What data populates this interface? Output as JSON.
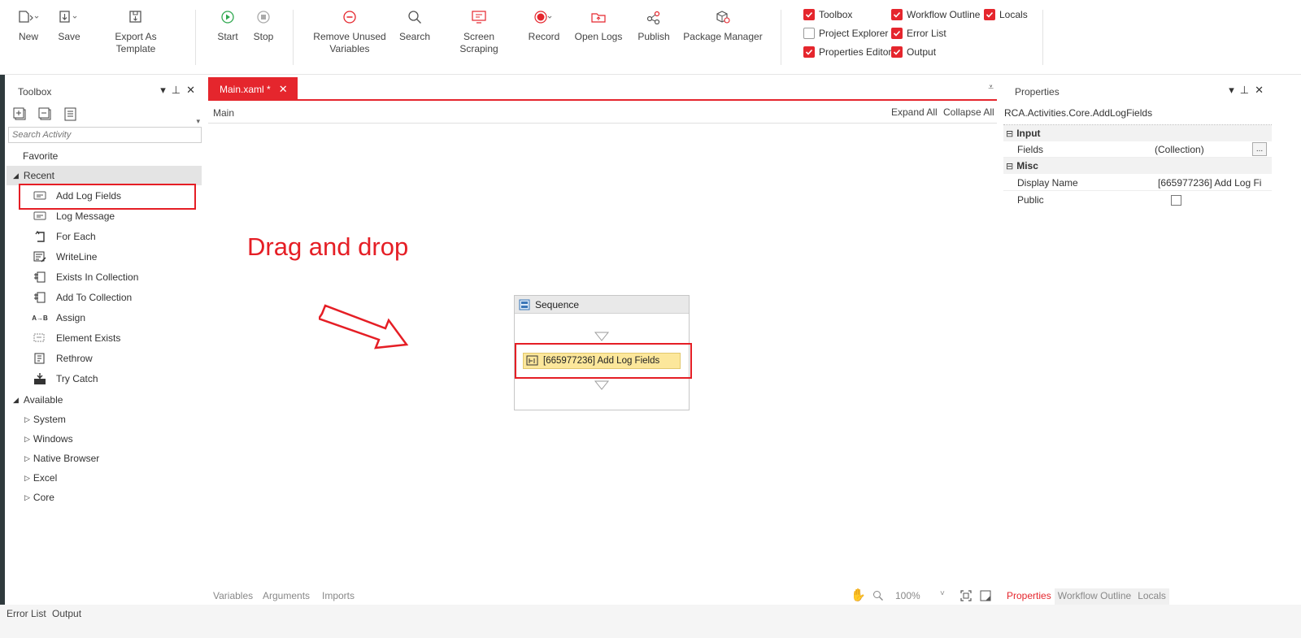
{
  "ribbon": {
    "new": "New",
    "save": "Save",
    "export_template": "Export As Template",
    "start": "Start",
    "stop": "Stop",
    "remove_unused_1": "Remove Unused",
    "remove_unused_2": "Variables",
    "search": "Search",
    "screen_scraping": "Screen Scraping",
    "record": "Record",
    "open_logs": "Open Logs",
    "publish": "Publish",
    "package_manager": "Package Manager",
    "checks": {
      "toolbox": "Toolbox",
      "workflow_outline": "Workflow Outline",
      "locals": "Locals",
      "project_explorer": "Project Explorer",
      "error_list": "Error List",
      "properties_editor": "Properties Editor",
      "output": "Output"
    }
  },
  "toolbox": {
    "title": "Toolbox",
    "search_placeholder": "Search Activity",
    "favorite": "Favorite",
    "recent": "Recent",
    "recent_items": [
      "Add Log Fields",
      "Log Message",
      "For Each",
      "WriteLine",
      "Exists In Collection",
      "Add To Collection",
      "Assign",
      "Element Exists",
      "Rethrow",
      "Try Catch"
    ],
    "available": "Available",
    "available_items": [
      "System",
      "Windows",
      "Native Browser",
      "Excel",
      "Core"
    ]
  },
  "designer": {
    "tab": "Main.xaml *",
    "breadcrumb": "Main",
    "expand_all": "Expand All",
    "collapse_all": "Collapse All",
    "annotation": "Drag and drop",
    "sequence_title": "Sequence",
    "activity_label": "[665977236] Add Log Fields",
    "footer": {
      "variables": "Variables",
      "arguments": "Arguments",
      "imports": "Imports",
      "zoom": "100%"
    }
  },
  "properties": {
    "title": "Properties",
    "type_name": "RCA.Activities.Core.AddLogFields",
    "cat_input": "Input",
    "fields_label": "Fields",
    "fields_value": "(Collection)",
    "ellipsis": "...",
    "cat_misc": "Misc",
    "display_name_label": "Display Name",
    "display_name_value": "[665977236] Add Log Fi",
    "public_label": "Public",
    "tabs": [
      "Properties",
      "Workflow Outline",
      "Locals"
    ]
  },
  "bottom": {
    "error_list": "Error List",
    "output": "Output"
  },
  "colors": {
    "accent": "#e5262d",
    "activity_fill": "#fce79b"
  }
}
